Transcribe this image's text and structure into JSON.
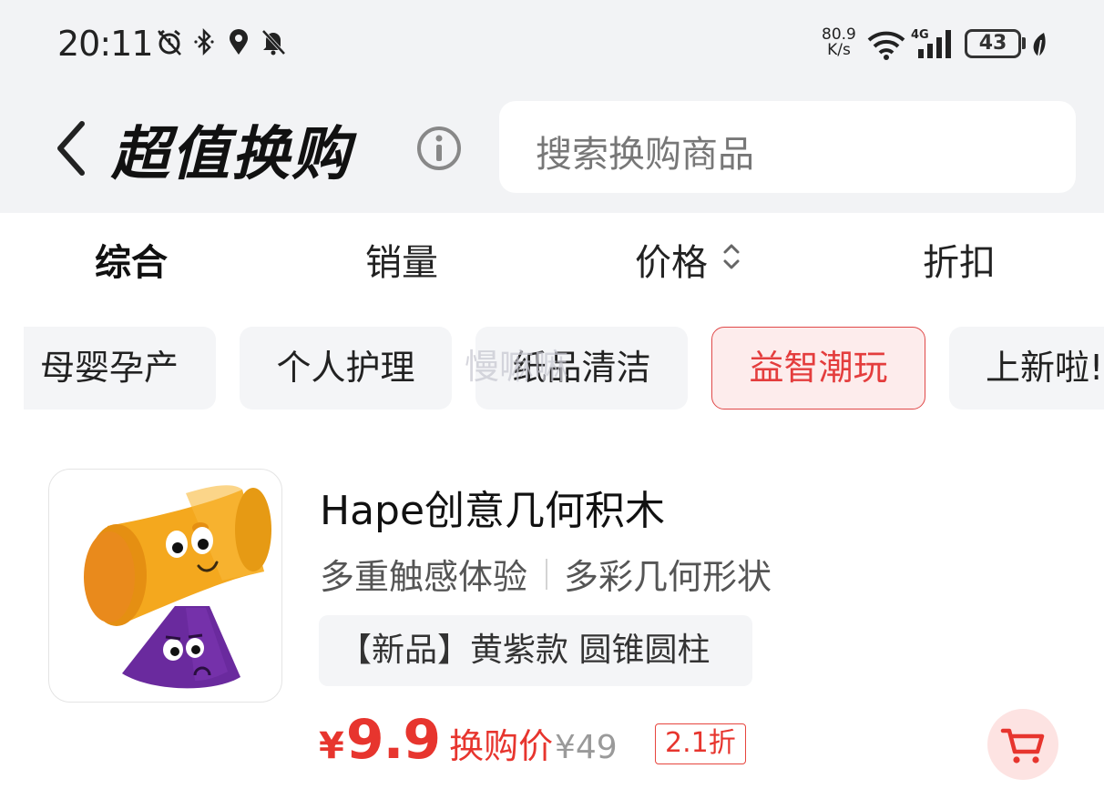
{
  "status_bar": {
    "time": "20:11",
    "net_speed_value": "80.9",
    "net_speed_unit": "K/s",
    "network": "4G",
    "battery": "43",
    "icons": [
      "alarm-icon",
      "bluetooth-icon",
      "location-icon",
      "mute-bell-icon",
      "wifi-icon",
      "signal-icon",
      "battery-icon",
      "leaf-icon"
    ]
  },
  "header": {
    "title": "超值换购",
    "search_placeholder": "搜索换购商品"
  },
  "sort_tabs": [
    "综合",
    "销量",
    "价格",
    "折扣"
  ],
  "active_sort": "综合",
  "categories": [
    "母婴孕产",
    "个人护理",
    "纸品清洁",
    "益智潮玩",
    "上新啦!"
  ],
  "active_category": "益智潮玩",
  "watermark": "慢嘛嘛",
  "product": {
    "name": "Hape创意几何积木",
    "feature_1": "多重触感体验",
    "feature_2": "多彩几何形状",
    "variant": "【新品】黄紫款 圆锥圆柱",
    "currency": "¥",
    "price": "9.9",
    "price_label": "换购价",
    "original_price": "¥49",
    "discount": "2.1折"
  },
  "colors": {
    "accent": "#e7352e",
    "chip_active_bg": "#fdecec",
    "header_bg": "#f2f3f5"
  }
}
